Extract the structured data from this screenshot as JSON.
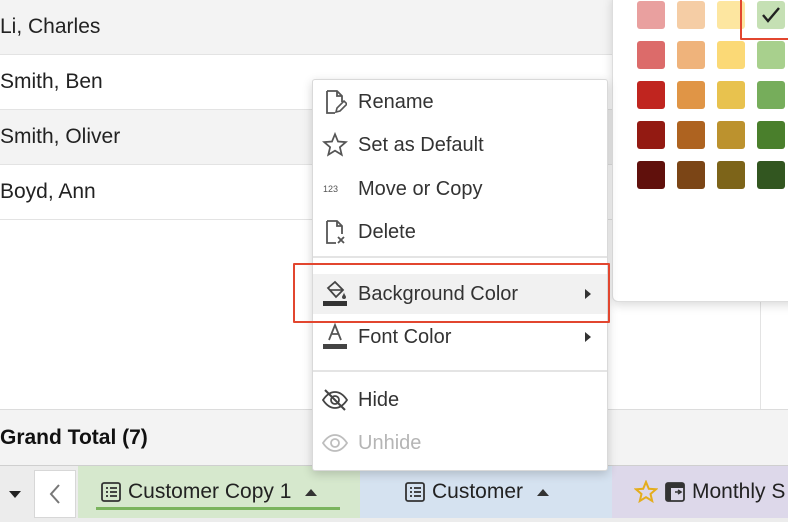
{
  "rows": [
    {
      "name": "Li, Charles"
    },
    {
      "name": "Smith, Ben"
    },
    {
      "name": "Smith, Oliver"
    },
    {
      "name": "Boyd, Ann"
    }
  ],
  "grand_total": "Grand Total (7)",
  "context_menu": {
    "items": [
      {
        "label": "Rename",
        "icon": "rename-icon"
      },
      {
        "label": "Set as Default",
        "icon": "star-icon"
      },
      {
        "label": "Move or Copy",
        "icon": "move-copy-icon"
      },
      {
        "label": "Delete",
        "icon": "delete-icon"
      },
      {
        "label": "Background Color",
        "icon": "paint-bucket-icon",
        "submenu": true,
        "highlighted": true
      },
      {
        "label": "Font Color",
        "icon": "font-color-icon",
        "submenu": true
      },
      {
        "label": "Hide",
        "icon": "eye-slash-icon"
      },
      {
        "label": "Unhide",
        "icon": "eye-icon",
        "disabled": true
      }
    ]
  },
  "palette": {
    "selected": "#c5e0b4",
    "colors": [
      [
        "#e9a09f",
        "#f5cda5",
        "#fde6a0",
        "#c5e0b4"
      ],
      [
        "#dc6b6a",
        "#efb37b",
        "#fbd976",
        "#a8d08d"
      ],
      [
        "#c0251f",
        "#e09546",
        "#e8c24e",
        "#76ad5b"
      ],
      [
        "#931a12",
        "#ae6320",
        "#bc922e",
        "#4a7f2c"
      ],
      [
        "#60100c",
        "#7b4516",
        "#7d6419",
        "#325620"
      ]
    ]
  },
  "tabs": [
    {
      "label": "Customer Copy 1",
      "icon": "table-icon",
      "active": true
    },
    {
      "label": "Customer",
      "icon": "table-icon"
    },
    {
      "label": "Monthly S",
      "icon": "star-icon"
    }
  ]
}
